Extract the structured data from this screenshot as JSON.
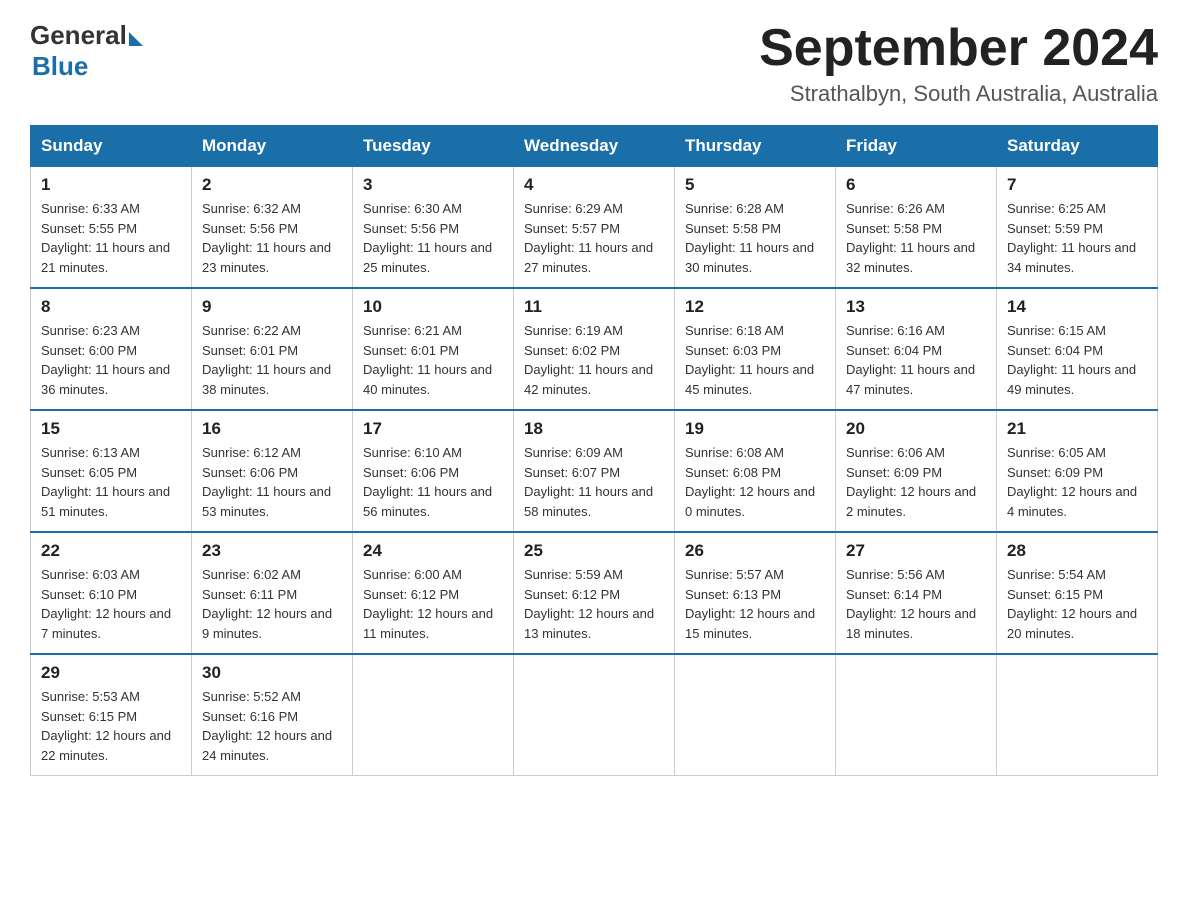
{
  "header": {
    "logo_general": "General",
    "logo_blue": "Blue",
    "month_title": "September 2024",
    "location": "Strathalbyn, South Australia, Australia"
  },
  "days_of_week": [
    "Sunday",
    "Monday",
    "Tuesday",
    "Wednesday",
    "Thursday",
    "Friday",
    "Saturday"
  ],
  "weeks": [
    [
      {
        "day": "1",
        "sunrise": "6:33 AM",
        "sunset": "5:55 PM",
        "daylight": "11 hours and 21 minutes."
      },
      {
        "day": "2",
        "sunrise": "6:32 AM",
        "sunset": "5:56 PM",
        "daylight": "11 hours and 23 minutes."
      },
      {
        "day": "3",
        "sunrise": "6:30 AM",
        "sunset": "5:56 PM",
        "daylight": "11 hours and 25 minutes."
      },
      {
        "day": "4",
        "sunrise": "6:29 AM",
        "sunset": "5:57 PM",
        "daylight": "11 hours and 27 minutes."
      },
      {
        "day": "5",
        "sunrise": "6:28 AM",
        "sunset": "5:58 PM",
        "daylight": "11 hours and 30 minutes."
      },
      {
        "day": "6",
        "sunrise": "6:26 AM",
        "sunset": "5:58 PM",
        "daylight": "11 hours and 32 minutes."
      },
      {
        "day": "7",
        "sunrise": "6:25 AM",
        "sunset": "5:59 PM",
        "daylight": "11 hours and 34 minutes."
      }
    ],
    [
      {
        "day": "8",
        "sunrise": "6:23 AM",
        "sunset": "6:00 PM",
        "daylight": "11 hours and 36 minutes."
      },
      {
        "day": "9",
        "sunrise": "6:22 AM",
        "sunset": "6:01 PM",
        "daylight": "11 hours and 38 minutes."
      },
      {
        "day": "10",
        "sunrise": "6:21 AM",
        "sunset": "6:01 PM",
        "daylight": "11 hours and 40 minutes."
      },
      {
        "day": "11",
        "sunrise": "6:19 AM",
        "sunset": "6:02 PM",
        "daylight": "11 hours and 42 minutes."
      },
      {
        "day": "12",
        "sunrise": "6:18 AM",
        "sunset": "6:03 PM",
        "daylight": "11 hours and 45 minutes."
      },
      {
        "day": "13",
        "sunrise": "6:16 AM",
        "sunset": "6:04 PM",
        "daylight": "11 hours and 47 minutes."
      },
      {
        "day": "14",
        "sunrise": "6:15 AM",
        "sunset": "6:04 PM",
        "daylight": "11 hours and 49 minutes."
      }
    ],
    [
      {
        "day": "15",
        "sunrise": "6:13 AM",
        "sunset": "6:05 PM",
        "daylight": "11 hours and 51 minutes."
      },
      {
        "day": "16",
        "sunrise": "6:12 AM",
        "sunset": "6:06 PM",
        "daylight": "11 hours and 53 minutes."
      },
      {
        "day": "17",
        "sunrise": "6:10 AM",
        "sunset": "6:06 PM",
        "daylight": "11 hours and 56 minutes."
      },
      {
        "day": "18",
        "sunrise": "6:09 AM",
        "sunset": "6:07 PM",
        "daylight": "11 hours and 58 minutes."
      },
      {
        "day": "19",
        "sunrise": "6:08 AM",
        "sunset": "6:08 PM",
        "daylight": "12 hours and 0 minutes."
      },
      {
        "day": "20",
        "sunrise": "6:06 AM",
        "sunset": "6:09 PM",
        "daylight": "12 hours and 2 minutes."
      },
      {
        "day": "21",
        "sunrise": "6:05 AM",
        "sunset": "6:09 PM",
        "daylight": "12 hours and 4 minutes."
      }
    ],
    [
      {
        "day": "22",
        "sunrise": "6:03 AM",
        "sunset": "6:10 PM",
        "daylight": "12 hours and 7 minutes."
      },
      {
        "day": "23",
        "sunrise": "6:02 AM",
        "sunset": "6:11 PM",
        "daylight": "12 hours and 9 minutes."
      },
      {
        "day": "24",
        "sunrise": "6:00 AM",
        "sunset": "6:12 PM",
        "daylight": "12 hours and 11 minutes."
      },
      {
        "day": "25",
        "sunrise": "5:59 AM",
        "sunset": "6:12 PM",
        "daylight": "12 hours and 13 minutes."
      },
      {
        "day": "26",
        "sunrise": "5:57 AM",
        "sunset": "6:13 PM",
        "daylight": "12 hours and 15 minutes."
      },
      {
        "day": "27",
        "sunrise": "5:56 AM",
        "sunset": "6:14 PM",
        "daylight": "12 hours and 18 minutes."
      },
      {
        "day": "28",
        "sunrise": "5:54 AM",
        "sunset": "6:15 PM",
        "daylight": "12 hours and 20 minutes."
      }
    ],
    [
      {
        "day": "29",
        "sunrise": "5:53 AM",
        "sunset": "6:15 PM",
        "daylight": "12 hours and 22 minutes."
      },
      {
        "day": "30",
        "sunrise": "5:52 AM",
        "sunset": "6:16 PM",
        "daylight": "12 hours and 24 minutes."
      },
      null,
      null,
      null,
      null,
      null
    ]
  ],
  "labels": {
    "sunrise": "Sunrise: ",
    "sunset": "Sunset: ",
    "daylight": "Daylight: "
  }
}
